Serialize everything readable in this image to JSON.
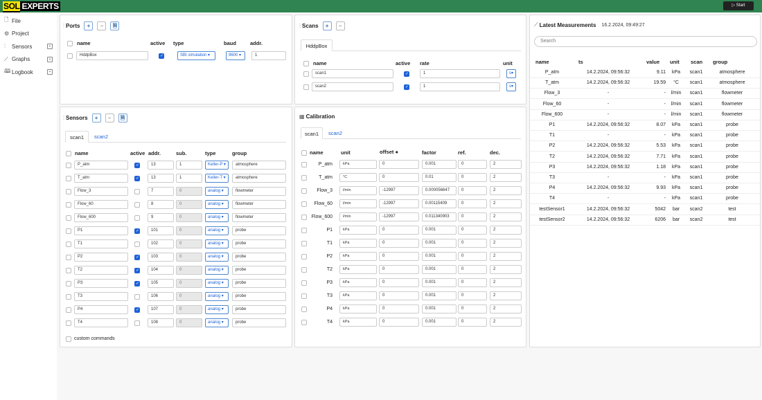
{
  "app": {
    "logo_a": "SOL",
    "logo_b": "EXPERTS",
    "start_label": "▷ Start"
  },
  "sidebar": {
    "items": [
      {
        "label": "File",
        "icon": "file-icon",
        "glyph": "🗋",
        "exp": false
      },
      {
        "label": "Project",
        "icon": "gear-icon",
        "glyph": "⚙",
        "exp": false
      },
      {
        "label": "Sensors",
        "icon": "sensors-icon",
        "glyph": "⫶",
        "exp": true
      },
      {
        "label": "Graphs",
        "icon": "graph-icon",
        "glyph": "⟋",
        "exp": true
      },
      {
        "label": "Logbook",
        "icon": "book-icon",
        "glyph": "🕮",
        "exp": true
      }
    ]
  },
  "ports": {
    "title": "Ports",
    "headers": [
      "name",
      "active",
      "type",
      "baud",
      "addr."
    ],
    "row": {
      "name": "HddpBox",
      "type": "SBI simulation",
      "baud": "9600",
      "addr": "1"
    }
  },
  "scans": {
    "title": "Scans",
    "tab": "HddpBox",
    "headers": [
      "name",
      "active",
      "rate",
      "unit"
    ],
    "rows": [
      {
        "name": "scan1",
        "rate": "1",
        "unit": "s"
      },
      {
        "name": "scan2",
        "rate": "1",
        "unit": "s"
      }
    ]
  },
  "sensors": {
    "title": "Sensors",
    "tabs": [
      "scan1",
      "scan2"
    ],
    "headers": [
      "name",
      "active",
      "addr.",
      "sub.",
      "type",
      "group"
    ],
    "custom_label": "custom commands",
    "rows": [
      {
        "name": "P_atm",
        "active": true,
        "addr": "13",
        "sub": "1",
        "type": "Keller-P",
        "group": "atmosphere",
        "sd": false
      },
      {
        "name": "T_atm",
        "active": true,
        "addr": "13",
        "sub": "1",
        "type": "Keller-T",
        "group": "atmosphere",
        "sd": false
      },
      {
        "name": "Flow_3",
        "active": false,
        "addr": "7",
        "sub": "0",
        "type": "analog",
        "group": "flowmeter",
        "sd": true
      },
      {
        "name": "Flow_60",
        "active": false,
        "addr": "8",
        "sub": "0",
        "type": "analog",
        "group": "flowmeter",
        "sd": true
      },
      {
        "name": "Flow_600",
        "active": false,
        "addr": "9",
        "sub": "0",
        "type": "analog",
        "group": "flowmeter",
        "sd": true
      },
      {
        "name": "P1",
        "active": true,
        "addr": "101",
        "sub": "0",
        "type": "analog",
        "group": "probe",
        "sd": true
      },
      {
        "name": "T1",
        "active": false,
        "addr": "102",
        "sub": "0",
        "type": "analog",
        "group": "probe",
        "sd": true
      },
      {
        "name": "P2",
        "active": true,
        "addr": "103",
        "sub": "0",
        "type": "analog",
        "group": "probe",
        "sd": true
      },
      {
        "name": "T2",
        "active": true,
        "addr": "104",
        "sub": "0",
        "type": "analog",
        "group": "probe",
        "sd": true
      },
      {
        "name": "P3",
        "active": true,
        "addr": "105",
        "sub": "0",
        "type": "analog",
        "group": "probe",
        "sd": true
      },
      {
        "name": "T3",
        "active": false,
        "addr": "106",
        "sub": "0",
        "type": "analog",
        "group": "probe",
        "sd": true
      },
      {
        "name": "P4",
        "active": true,
        "addr": "107",
        "sub": "0",
        "type": "analog",
        "group": "probe",
        "sd": true
      },
      {
        "name": "T4",
        "active": false,
        "addr": "108",
        "sub": "0",
        "type": "analog",
        "group": "probe",
        "sd": true
      }
    ]
  },
  "calibration": {
    "title": "Calibration",
    "tabs": [
      "scan1",
      "scan2"
    ],
    "headers": [
      "name",
      "unit",
      "offset",
      "factor",
      "ref.",
      "dec."
    ],
    "rows": [
      {
        "name": "P_atm",
        "unit": "kPa",
        "offset": "0",
        "factor": "0.001",
        "ref": "0",
        "dec": "2"
      },
      {
        "name": "T_atm",
        "unit": "°C",
        "offset": "0",
        "factor": "0.01",
        "ref": "0",
        "dec": "2"
      },
      {
        "name": "Flow_3",
        "unit": "l/min",
        "offset": "-12997",
        "factor": "0.000056647",
        "ref": "0",
        "dec": "2"
      },
      {
        "name": "Flow_60",
        "unit": "l/min",
        "offset": "-12997",
        "factor": "0.00115409",
        "ref": "0",
        "dec": "2"
      },
      {
        "name": "Flow_600",
        "unit": "l/min",
        "offset": "-12997",
        "factor": "0.011340903",
        "ref": "0",
        "dec": "2"
      },
      {
        "name": "P1",
        "unit": "kPa",
        "offset": "0",
        "factor": "0.001",
        "ref": "0",
        "dec": "2"
      },
      {
        "name": "T1",
        "unit": "kPa",
        "offset": "0",
        "factor": "0.001",
        "ref": "0",
        "dec": "2"
      },
      {
        "name": "P2",
        "unit": "kPa",
        "offset": "0",
        "factor": "0.001",
        "ref": "0",
        "dec": "2"
      },
      {
        "name": "T2",
        "unit": "kPa",
        "offset": "0",
        "factor": "0.001",
        "ref": "0",
        "dec": "2"
      },
      {
        "name": "P3",
        "unit": "kPa",
        "offset": "0",
        "factor": "0.001",
        "ref": "0",
        "dec": "2"
      },
      {
        "name": "T3",
        "unit": "kPa",
        "offset": "0",
        "factor": "0.001",
        "ref": "0",
        "dec": "2"
      },
      {
        "name": "P4",
        "unit": "kPa",
        "offset": "0",
        "factor": "0.001",
        "ref": "0",
        "dec": "2"
      },
      {
        "name": "T4",
        "unit": "kPa",
        "offset": "0",
        "factor": "0.001",
        "ref": "0",
        "dec": "2"
      }
    ]
  },
  "measurements": {
    "title": "Latest Measurements",
    "date": "16.2.2024, 09:49:27",
    "search_placeholder": "Search",
    "headers": [
      "name",
      "ts",
      "value",
      "unit",
      "scan",
      "group"
    ],
    "rows": [
      [
        "P_atm",
        "14.2.2024, 09:56:32",
        "9.11",
        "kPa",
        "scan1",
        "atmosphere"
      ],
      [
        "T_atm",
        "14.2.2024, 09:56:32",
        "19.59",
        "°C",
        "scan1",
        "atmosphere"
      ],
      [
        "Flow_3",
        "-",
        "-",
        "l/min",
        "scan1",
        "flowmeter"
      ],
      [
        "Flow_60",
        "-",
        "-",
        "l/min",
        "scan1",
        "flowmeter"
      ],
      [
        "Flow_600",
        "-",
        "-",
        "l/min",
        "scan1",
        "flowmeter"
      ],
      [
        "P1",
        "14.2.2024, 09:56:32",
        "8.07",
        "kPa",
        "scan1",
        "probe"
      ],
      [
        "T1",
        "-",
        "-",
        "kPa",
        "scan1",
        "probe"
      ],
      [
        "P2",
        "14.2.2024, 09:56:32",
        "5.53",
        "kPa",
        "scan1",
        "probe"
      ],
      [
        "T2",
        "14.2.2024, 09:56:32",
        "7.71",
        "kPa",
        "scan1",
        "probe"
      ],
      [
        "P3",
        "14.2.2024, 09:56:32",
        "1.18",
        "kPa",
        "scan1",
        "probe"
      ],
      [
        "T3",
        "-",
        "-",
        "kPa",
        "scan1",
        "probe"
      ],
      [
        "P4",
        "14.2.2024, 09:56:32",
        "9.93",
        "kPa",
        "scan1",
        "probe"
      ],
      [
        "T4",
        "-",
        "-",
        "kPa",
        "scan1",
        "probe"
      ],
      [
        "testSensor1",
        "14.2.2024, 09:56:32",
        "5042",
        "bar",
        "scan2",
        "test"
      ],
      [
        "testSensor2",
        "14.2.2024, 09:56:32",
        "6206",
        "bar",
        "scan2",
        "test"
      ]
    ]
  }
}
